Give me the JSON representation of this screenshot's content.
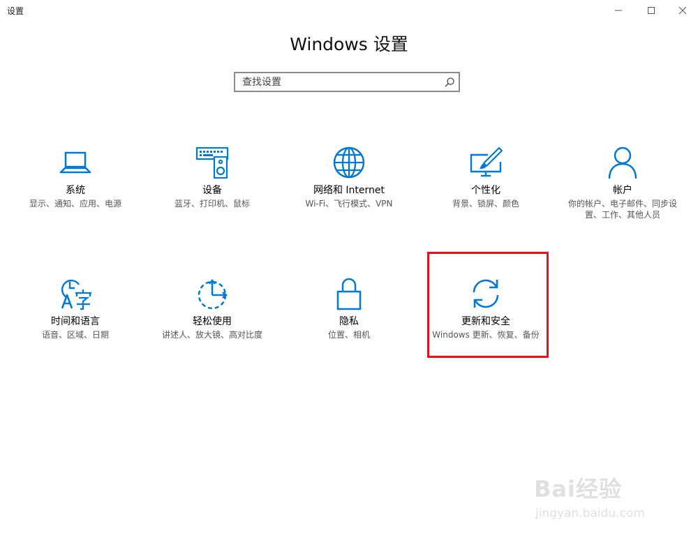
{
  "window": {
    "title": "设置",
    "controls": {
      "minimize": "minimize-icon",
      "maximize": "maximize-icon",
      "close": "close-icon"
    }
  },
  "heading": "Windows 设置",
  "search": {
    "placeholder": "查找设置",
    "icon": "search-icon"
  },
  "accent_color": "#0078d7",
  "highlight_color": "#e3121c",
  "tiles": [
    {
      "icon": "laptop-icon",
      "title": "系统",
      "desc": "显示、通知、应用、电源"
    },
    {
      "icon": "keyboard-speaker-icon",
      "title": "设备",
      "desc": "蓝牙、打印机、鼠标"
    },
    {
      "icon": "globe-icon",
      "title": "网络和 Internet",
      "desc": "Wi-Fi、飞行模式、VPN"
    },
    {
      "icon": "paintbrush-display-icon",
      "title": "个性化",
      "desc": "背景、锁屏、颜色"
    },
    {
      "icon": "person-icon",
      "title": "帐户",
      "desc": "你的帐户、电子邮件、同步设置、工作、其他人员"
    },
    {
      "icon": "time-language-icon",
      "title": "时间和语言",
      "desc": "语音、区域、日期"
    },
    {
      "icon": "ease-of-access-icon",
      "title": "轻松使用",
      "desc": "讲述人、放大镜、高对比度"
    },
    {
      "icon": "lock-icon",
      "title": "隐私",
      "desc": "位置、相机"
    },
    {
      "icon": "sync-arrows-icon",
      "title": "更新和安全",
      "desc": "Windows 更新、恢复、备份"
    }
  ],
  "watermark": {
    "brand": "Bai经验",
    "url": "jingyan.baidu.com"
  }
}
